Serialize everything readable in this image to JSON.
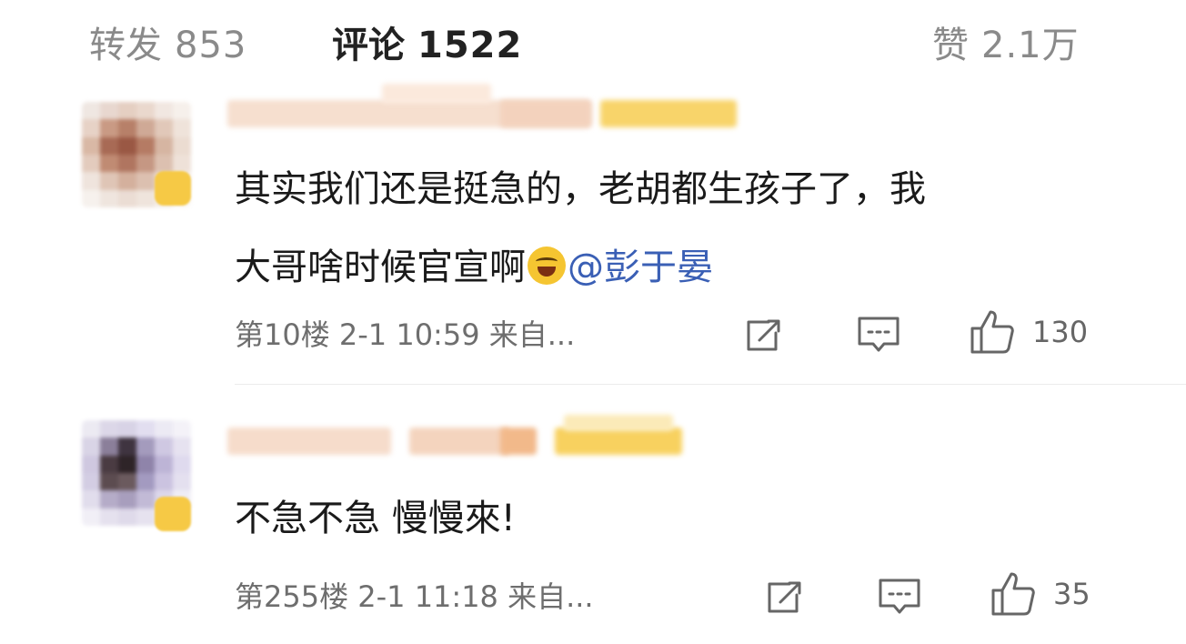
{
  "tabs": {
    "repost": {
      "label": "转发",
      "count": "853"
    },
    "comments": {
      "label": "评论",
      "count": "1522"
    },
    "likes": {
      "label": "赞",
      "count": "2.1万"
    }
  },
  "comments": [
    {
      "text_line1": "其实我们还是挺急的，老胡都生孩子了，我",
      "text_line2_prefix": "大哥啥时候官宣啊",
      "emoji": "laughing-tears-emoji",
      "mention": "@彭于晏",
      "meta": "第10楼 2-1 10:59 来自...",
      "like_count": "130"
    },
    {
      "text": "不急不急 慢慢來!",
      "meta": "第255楼 2-1 11:18 来自...",
      "like_count": "35"
    }
  ],
  "colors": {
    "mention": "#3a5fb5",
    "vip_badge": "#f6c945",
    "muted_text": "#8a8a8a"
  },
  "icons": {
    "repost": "repost-icon",
    "comment": "comment-icon",
    "like": "thumbs-up-icon"
  }
}
